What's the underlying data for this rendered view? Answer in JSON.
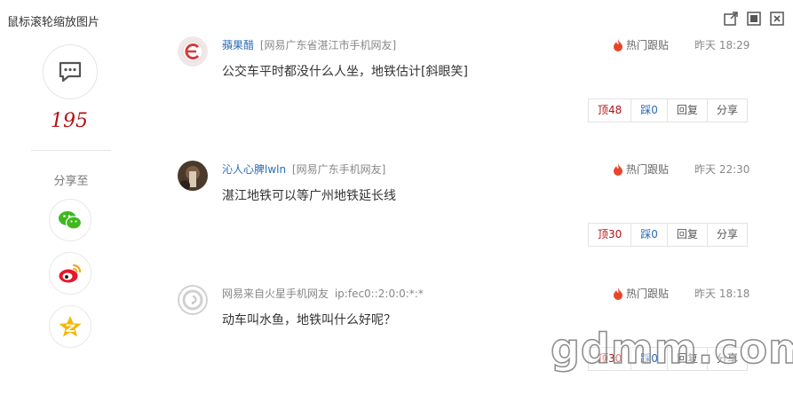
{
  "page": {
    "hint": "鼠标滚轮缩放图片"
  },
  "window_controls": {
    "icons": [
      "external-link-icon",
      "fullscreen-icon",
      "close-icon"
    ]
  },
  "sidebar": {
    "comment_count": "195",
    "share_label": "分享至",
    "share_targets": [
      "wechat-icon",
      "weibo-icon",
      "qzone-icon"
    ],
    "colors": {
      "count": "#b31313",
      "wechat": "#3fb81d",
      "weibo": "#e6162d",
      "qzone": "#f7b500"
    }
  },
  "comments": [
    {
      "username": "蘋果醋",
      "location": "[网易广东省湛江市手机网友]",
      "hot_label": "热门跟贴",
      "time": "昨天 18:29",
      "text": "公交车平时都没什么人坐，地铁估计[斜眼笑]",
      "actions": {
        "up": "顶48",
        "down": "踩0",
        "reply": "回复",
        "share": "分享"
      }
    },
    {
      "username": "沁人心脾lwln",
      "location": "[网易广东手机网友]",
      "hot_label": "热门跟贴",
      "time": "昨天 22:30",
      "text": "湛江地铁可以等广州地铁延长线",
      "actions": {
        "up": "顶30",
        "down": "踩0",
        "reply": "回复",
        "share": "分享"
      }
    },
    {
      "username": "网易来自火星手机网友",
      "location": "ip:fec0::2:0:0:*:*",
      "hot_label": "热门跟贴",
      "time": "昨天 18:18",
      "text": "动车叫水鱼，地铁叫什么好呢？",
      "actions": {
        "up": "顶30",
        "down": "踩0",
        "reply": "回复",
        "share": "分享"
      }
    }
  ],
  "watermark": "gdmm.com",
  "colors": {
    "accent_red": "#b31313",
    "link_blue": "#2a6db5",
    "hot_red": "#e8462a"
  }
}
